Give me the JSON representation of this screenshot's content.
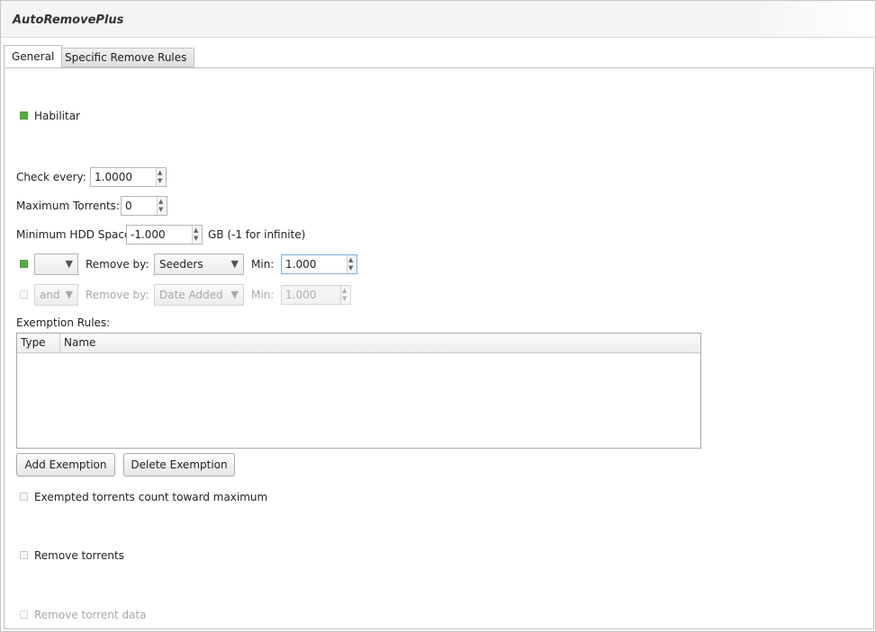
{
  "window": {
    "title": "AutoRemovePlus"
  },
  "tabs": [
    {
      "label": "General",
      "active": true
    },
    {
      "label": "Specific Remove Rules",
      "active": false
    }
  ],
  "general": {
    "enable": {
      "label": "Habilitar",
      "checked": true
    },
    "check_every": {
      "label": "Check every:",
      "value": "1.0000"
    },
    "max_torrents": {
      "label": "Maximum Torrents:",
      "value": "0"
    },
    "min_hdd": {
      "label": "Minimum HDD Space:",
      "value": "-1.000",
      "suffix": "GB (-1 for infinite)"
    },
    "rule1": {
      "checked": true,
      "operator": "",
      "remove_by_label": "Remove by:",
      "remove_by": "Seeders",
      "min_label": "Min:",
      "min_value": "1.000"
    },
    "rule2": {
      "checked": false,
      "operator": "and",
      "remove_by_label": "Remove by:",
      "remove_by": "Date Added",
      "min_label": "Min:",
      "min_value": "1.000"
    },
    "exemption_rules": {
      "label": "Exemption Rules:",
      "columns": [
        "Type",
        "Name"
      ],
      "rows": []
    },
    "add_exemption": "Add Exemption",
    "delete_exemption": "Delete Exemption",
    "exempted_count": {
      "label": "Exempted torrents count toward maximum",
      "checked": false
    },
    "remove_torrents": {
      "label": "Remove torrents",
      "checked": false
    },
    "remove_data": {
      "label": "Remove torrent data",
      "checked": false,
      "disabled": true
    }
  },
  "colors": {
    "checked_green": "#4caf3a",
    "focus_blue": "#7eadd9"
  }
}
